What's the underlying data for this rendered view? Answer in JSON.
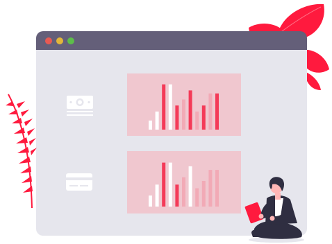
{
  "window": {
    "titlebar_color": "#645f79",
    "body_color": "#e6e6ed",
    "buttons": [
      {
        "name": "close",
        "color": "#e85a53"
      },
      {
        "name": "minimize",
        "color": "#e2b63a"
      },
      {
        "name": "maximize",
        "color": "#5dbd4a"
      }
    ]
  },
  "colors": {
    "accent": "#f43a58",
    "accent_light": "#f2aab6",
    "panel_fill": "#f0c7cf",
    "icon_white": "#ffffff",
    "leaf_red": "#ff1a3e",
    "dark": "#2f2e41",
    "skin": "#ffb6b6"
  },
  "icons": {
    "money": "banknote-icon",
    "card": "credit-card-icon"
  },
  "chart_data": [
    {
      "type": "bar",
      "series": [
        {
          "values": [
            3,
            6,
            15,
            15,
            8,
            10,
            13,
            6,
            8,
            12,
            12
          ]
        }
      ],
      "bar_colors": [
        "#ffffff",
        "#ffffff",
        "#f43a58",
        "#ffffff",
        "#f43a58",
        "#f2aab6",
        "#f43a58",
        "#f2aab6",
        "#f43a58",
        "#f2aab6",
        "#f43a58"
      ],
      "ylim": [
        0,
        17
      ]
    },
    {
      "type": "bar",
      "series": [
        {
          "values": [
            3,
            6,
            12,
            12,
            6,
            8,
            11,
            5,
            7,
            10,
            10
          ]
        }
      ],
      "bar_colors": [
        "#ffffff",
        "#ffffff",
        "#f43a58",
        "#ffffff",
        "#f43a58",
        "#f2aab6",
        "#ffffff",
        "#f2aab6",
        "#f2aab6",
        "#f2aab6",
        "#f2aab6"
      ],
      "ylim": [
        0,
        14
      ]
    }
  ]
}
